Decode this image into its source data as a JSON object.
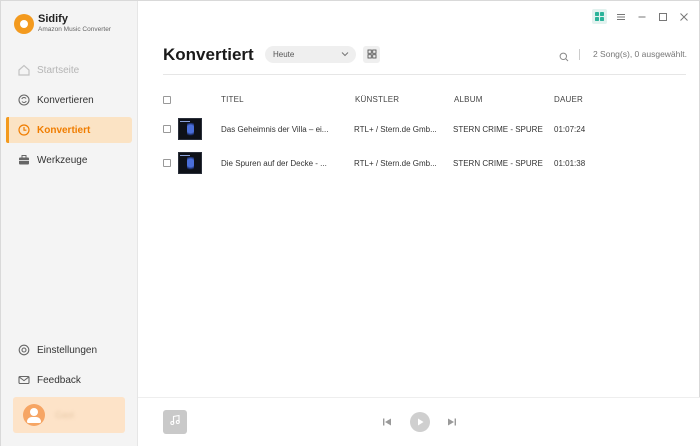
{
  "app": {
    "name": "Sidify",
    "subtitle": "Amazon Music Converter"
  },
  "sidebar": {
    "items": [
      {
        "label": "Startseite",
        "icon": "home-icon",
        "state": "disabled"
      },
      {
        "label": "Konvertieren",
        "icon": "convert-icon",
        "state": "normal"
      },
      {
        "label": "Konvertiert",
        "icon": "clock-icon",
        "state": "active"
      },
      {
        "label": "Werkzeuge",
        "icon": "toolbox-icon",
        "state": "normal"
      }
    ],
    "bottom_items": [
      {
        "label": "Einstellungen",
        "icon": "gear-icon"
      },
      {
        "label": "Feedback",
        "icon": "mail-icon"
      }
    ],
    "user": {
      "name": "Gast"
    }
  },
  "header": {
    "title": "Konvertiert",
    "date_filter": "Heute",
    "count_text": "2 Song(s), 0 ausgewählt."
  },
  "table": {
    "columns": [
      "TITEL",
      "KÜNSTLER",
      "ALBUM",
      "DAUER"
    ],
    "rows": [
      {
        "title": "Das Geheimnis der Villa – ei...",
        "artist": "RTL+ / Stern.de Gmb...",
        "album": "STERN CRIME - SPURE...",
        "duration": "01:07:24"
      },
      {
        "title": "Die Spuren auf der Decke - ...",
        "artist": "RTL+ / Stern.de Gmb...",
        "album": "STERN CRIME - SPURE...",
        "duration": "01:01:38"
      }
    ]
  },
  "colors": {
    "accent": "#f39a1e",
    "active_bg": "#fbe3c4",
    "teal": "#2bb39a"
  }
}
